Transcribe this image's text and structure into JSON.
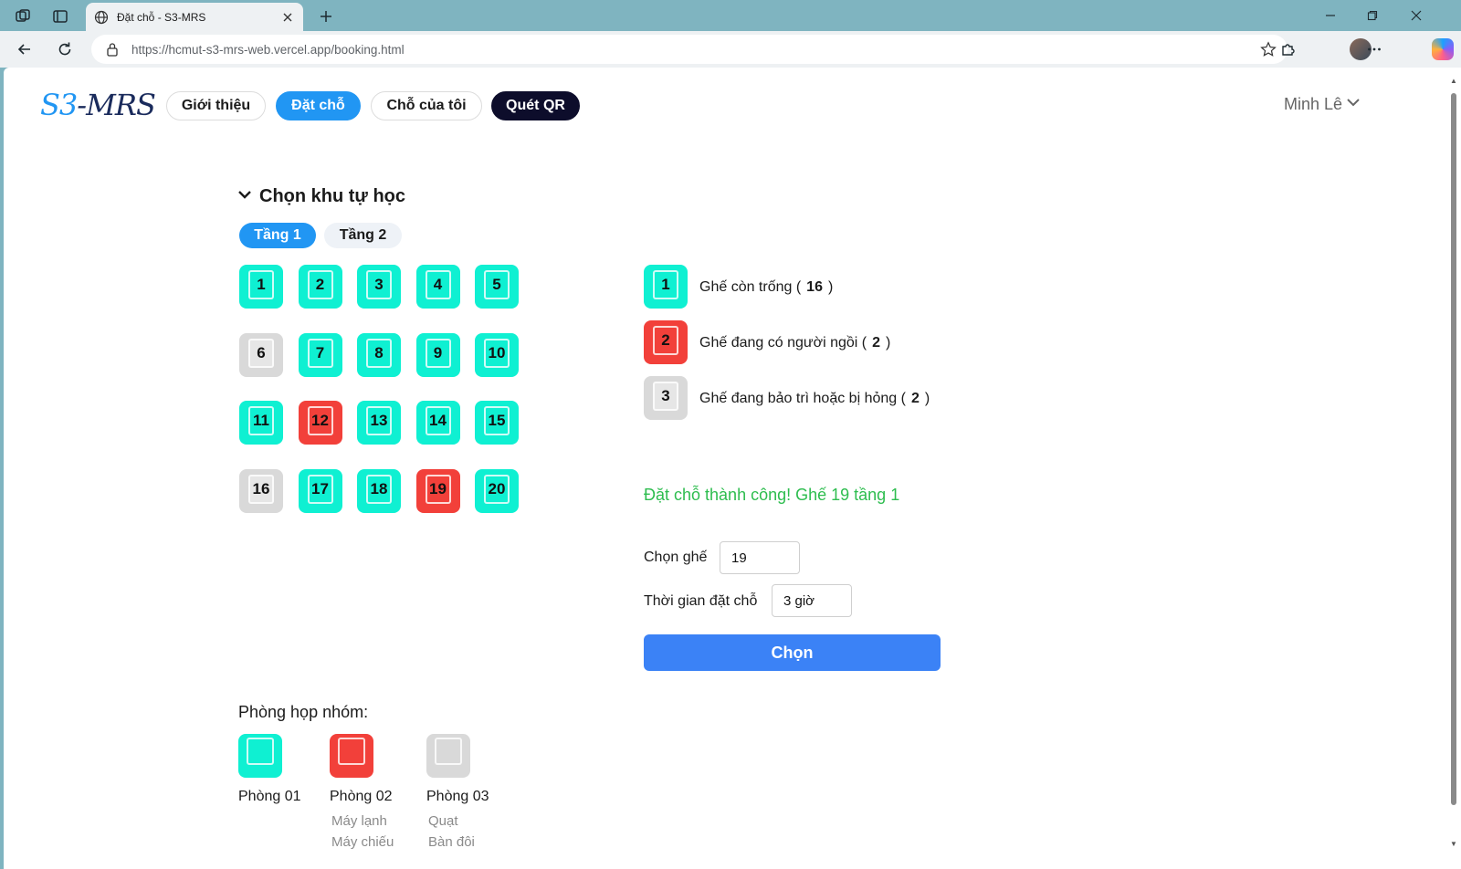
{
  "browser": {
    "tab_title": "Đặt chỗ - S3-MRS",
    "url_host": "https://hcmut-s3-mrs-web.vercel.app",
    "url_path": "/booking.html"
  },
  "header": {
    "logo_prefix": "S3",
    "logo_suffix": "-MRS",
    "nav": [
      {
        "label": "Giới thiệu",
        "state": "default"
      },
      {
        "label": "Đặt chỗ",
        "state": "active"
      },
      {
        "label": "Chỗ của tôi",
        "state": "default"
      },
      {
        "label": "Quét QR",
        "state": "dark"
      }
    ],
    "user_name": "Minh Lê"
  },
  "booking": {
    "section_title": "Chọn khu tự học",
    "floors": [
      "Tầng 1",
      "Tầng 2"
    ],
    "active_floor": "Tầng 1",
    "seats": [
      {
        "number": "1",
        "status": "free"
      },
      {
        "number": "2",
        "status": "free"
      },
      {
        "number": "3",
        "status": "free"
      },
      {
        "number": "4",
        "status": "free"
      },
      {
        "number": "5",
        "status": "free"
      },
      {
        "number": "6",
        "status": "broken"
      },
      {
        "number": "7",
        "status": "free"
      },
      {
        "number": "8",
        "status": "free"
      },
      {
        "number": "9",
        "status": "free"
      },
      {
        "number": "10",
        "status": "free"
      },
      {
        "number": "11",
        "status": "free"
      },
      {
        "number": "12",
        "status": "busy"
      },
      {
        "number": "13",
        "status": "free"
      },
      {
        "number": "14",
        "status": "free"
      },
      {
        "number": "15",
        "status": "free"
      },
      {
        "number": "16",
        "status": "broken"
      },
      {
        "number": "17",
        "status": "free"
      },
      {
        "number": "18",
        "status": "free"
      },
      {
        "number": "19",
        "status": "busy"
      },
      {
        "number": "20",
        "status": "free"
      }
    ],
    "legend": [
      {
        "sample": "1",
        "status": "free",
        "label": "Ghế còn trống (",
        "count": "16",
        "close": ")"
      },
      {
        "sample": "2",
        "status": "busy",
        "label": "Ghế đang có người ngồi (",
        "count": "2",
        "close": ")"
      },
      {
        "sample": "3",
        "status": "broken",
        "label": "Ghế đang bảo trì hoặc bị hỏng (",
        "count": "2",
        "close": ")"
      }
    ],
    "success_message": "Đặt chỗ thành công! Ghế 19 tầng 1",
    "seat_label": "Chọn ghế",
    "seat_value": "19",
    "duration_label": "Thời gian đặt chỗ",
    "duration_value": "3 giờ",
    "submit_label": "Chọn"
  },
  "rooms": {
    "title": "Phòng họp nhóm:",
    "items": [
      {
        "name": "Phòng 01",
        "status": "free",
        "features": []
      },
      {
        "name": "Phòng 02",
        "status": "busy",
        "features": [
          "Máy lạnh",
          "Máy chiếu"
        ]
      },
      {
        "name": "Phòng 03",
        "status": "broken",
        "features": [
          "Quạt",
          "Bàn đôi"
        ]
      }
    ]
  },
  "colors": {
    "free": "#0ff0d2",
    "busy": "#f2403a",
    "broken": "#d9d9d9",
    "accent": "#2196f3",
    "success": "#2ebd4f",
    "submit": "#3b82f6"
  },
  "icons": {
    "workspaces": "workspaces-icon",
    "tab_actions": "tab-actions-icon",
    "globe": "globe-icon",
    "close": "close-icon",
    "new_tab": "plus-icon",
    "back": "back-arrow-icon",
    "reload": "reload-icon",
    "lock": "site-info-icon",
    "favorite": "star-icon",
    "extensions": "puzzle-icon",
    "more": "more-icon",
    "dropdown": "chevron-down-icon"
  }
}
